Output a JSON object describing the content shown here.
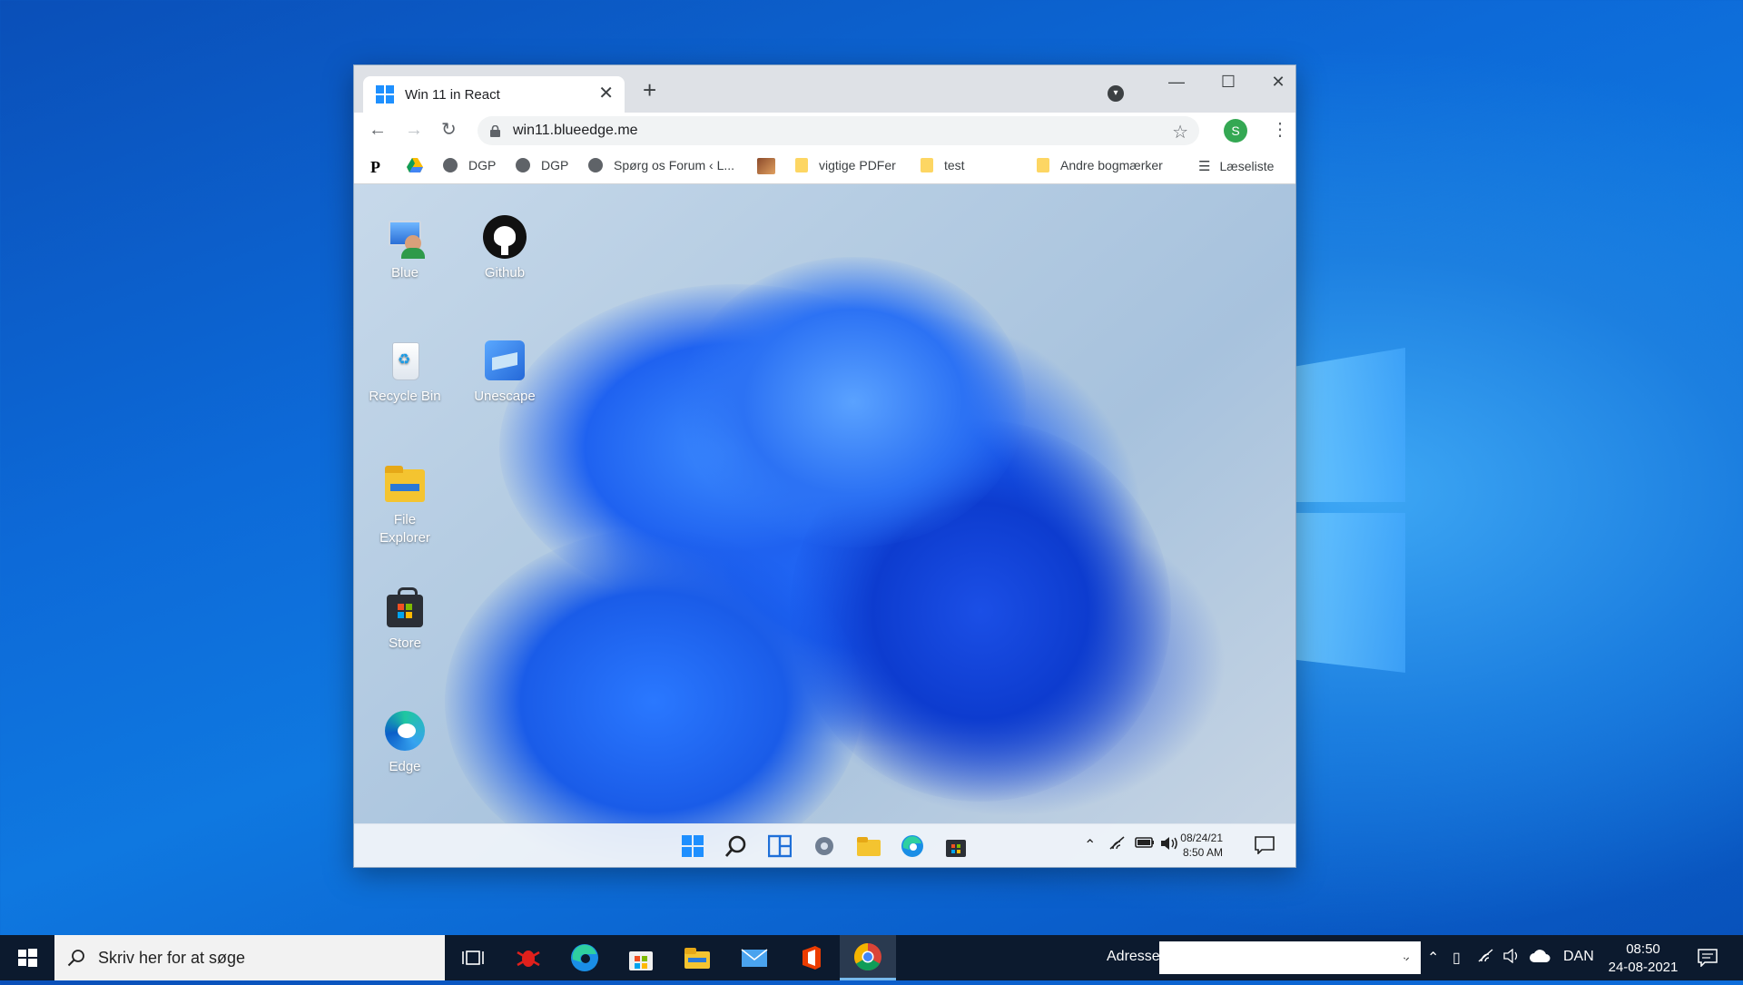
{
  "browser": {
    "tab_title": "Win 11 in React",
    "tab_close": "✕",
    "new_tab": "+",
    "url": "win11.blueedge.me",
    "profile_initial": "S",
    "window_controls": {
      "minimize": "—",
      "maximize": "☐",
      "close": "✕"
    },
    "bookmarks": [
      {
        "label": ""
      },
      {
        "label": ""
      },
      {
        "label": "DGP"
      },
      {
        "label": "DGP"
      },
      {
        "label": "Spørg os Forum ‹ L..."
      },
      {
        "label": ""
      },
      {
        "label": "vigtige PDFer"
      },
      {
        "label": "test"
      },
      {
        "label": "Andre bogmærker"
      },
      {
        "label": "Læseliste"
      }
    ]
  },
  "win11": {
    "desktop_icons": [
      {
        "label": "Blue"
      },
      {
        "label": "Github"
      },
      {
        "label": "Recycle Bin"
      },
      {
        "label": "Unescape"
      },
      {
        "label": "File Explorer"
      },
      {
        "label": "Store"
      },
      {
        "label": "Edge"
      }
    ],
    "clock": {
      "date": "08/24/21",
      "time": "8:50 AM"
    }
  },
  "taskbar": {
    "search_placeholder": "Skriv her for at søge",
    "address_label": "Adresse",
    "language": "DAN",
    "time": "08:50",
    "date": "24-08-2021"
  }
}
